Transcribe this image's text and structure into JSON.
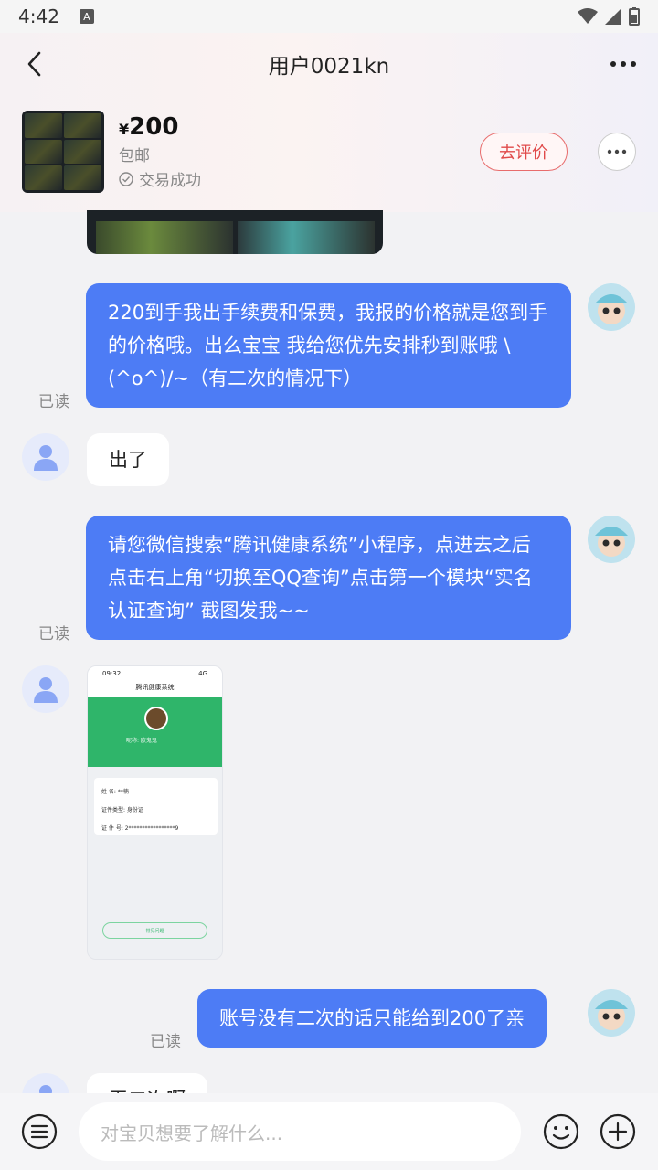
{
  "status_bar": {
    "time": "4:42",
    "badge": "A"
  },
  "header": {
    "title": "用户0021kn",
    "product": {
      "currency": "¥",
      "price": "200",
      "shipping": "包邮",
      "status": "交易成功"
    },
    "review_button": "去评价"
  },
  "messages": [
    {
      "from": "me",
      "type": "text",
      "text": "220到手我出手续费和保费，我报的价格就是您到手的价格哦。出么宝宝 我给您优先安排秒到账哦 \\(^o^)/~（有二次的情况下）",
      "read": "已读"
    },
    {
      "from": "other",
      "type": "text",
      "text": "出了"
    },
    {
      "from": "me",
      "type": "text",
      "text": "请您微信搜索“腾讯健康系统”小程序，点进去之后点击右上角“切换至QQ查询”点击第一个模块“实名认证查询” 截图发我~~",
      "read": "已读"
    },
    {
      "from": "other",
      "type": "image",
      "screenshot": {
        "time": "09:32",
        "signal": "4G",
        "title": "腾讯健康系统",
        "nickname": "昵称: 欧鬼鬼",
        "row1": "姓  名: **楠",
        "row2": "证件类型: 身份证",
        "row3": "证 件 号: 2*****************9",
        "button": "常见问题"
      }
    },
    {
      "from": "me",
      "type": "text",
      "text": "账号没有二次的话只能给到200了亲",
      "read": "已读"
    },
    {
      "from": "other",
      "type": "text",
      "text": "无二次啊"
    }
  ],
  "input": {
    "placeholder": "对宝贝想要了解什么..."
  },
  "colors": {
    "my_bubble": "#4d7cf5",
    "review_border": "#e86c6c"
  }
}
